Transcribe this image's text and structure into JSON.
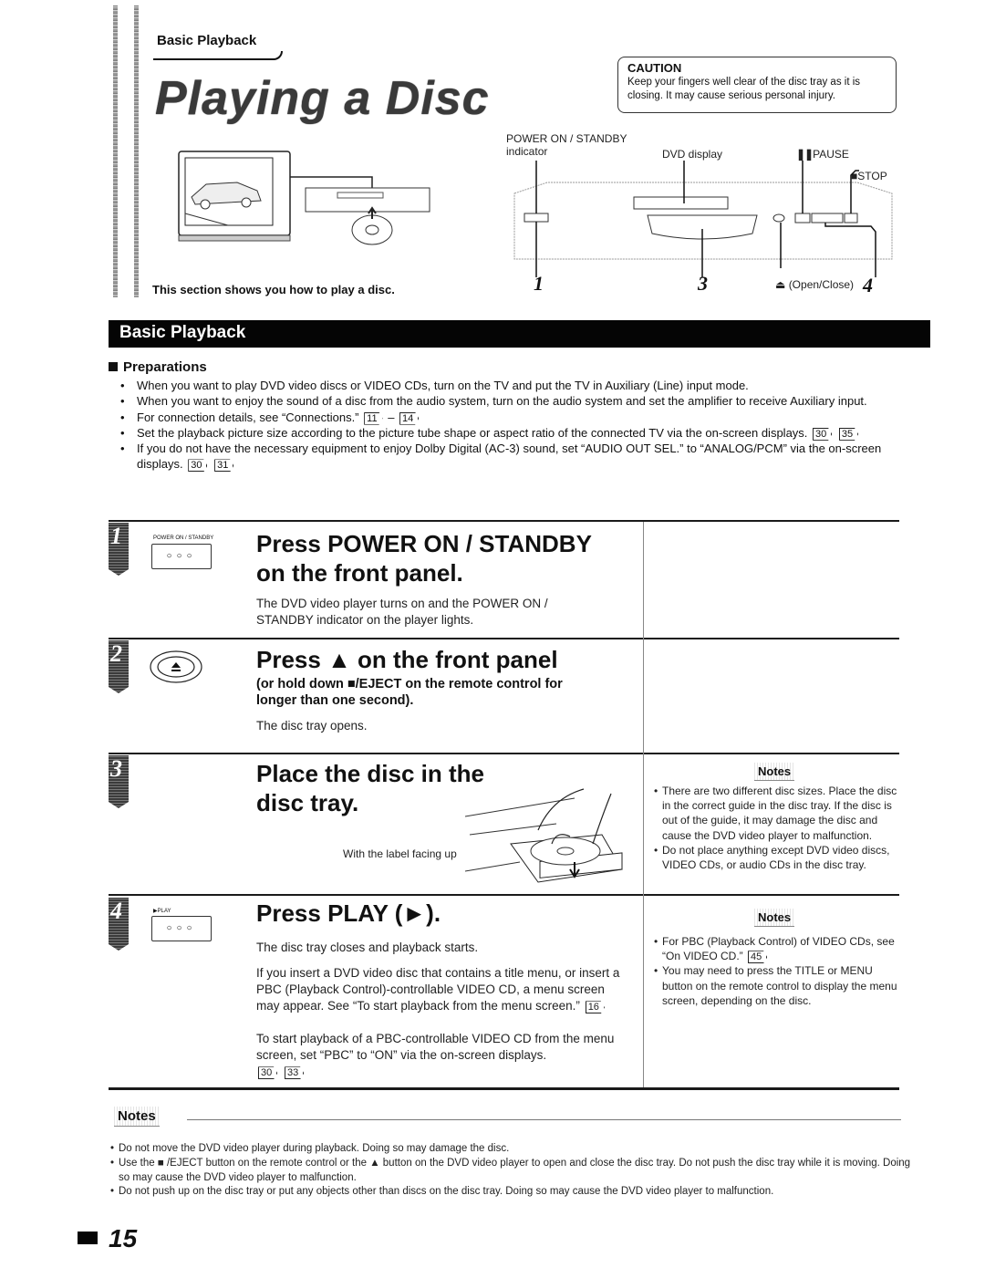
{
  "header": {
    "breadcrumb": "Basic Playback",
    "title": "Playing a Disc",
    "section_intro": "This section shows you how to play a disc."
  },
  "caution": {
    "title": "CAUTION",
    "text": "Keep your fingers well clear of the disc tray as it is closing. It may cause serious personal injury."
  },
  "diagram": {
    "labels": {
      "power_indicator_line1": "POWER ON / STANDBY",
      "power_indicator_line2": "indicator",
      "dvd_display": "DVD display",
      "pause": "PAUSE",
      "stop": "STOP",
      "open_close": "(Open/Close)"
    },
    "icons": {
      "pause": "pause-icon",
      "stop": "stop-icon",
      "eject": "eject-icon"
    },
    "step_numbers": [
      "1",
      "3",
      "4"
    ]
  },
  "section_band": {
    "title": "Basic Playback"
  },
  "preparations": {
    "heading": "Preparations",
    "items": [
      {
        "text": "When you want to play DVD video discs or VIDEO CDs, turn on the TV and put the TV in Auxiliary (Line) input mode.",
        "refs": []
      },
      {
        "text": "When you want to enjoy the sound of a disc from the audio system, turn on the audio system and set the amplifier to receive Auxiliary input.",
        "refs": []
      },
      {
        "text": "For connection details, see “Connections.”",
        "refs": [
          "11",
          "14"
        ],
        "ref_sep": "–"
      },
      {
        "text": "Set the playback picture size according to the picture tube shape or aspect ratio of the connected TV via the on-screen displays.",
        "refs": [
          "30",
          "35"
        ]
      },
      {
        "text": "If you do not have the necessary equipment to enjoy Dolby Digital (AC-3) sound, set “AUDIO OUT SEL.” to “ANALOG/PCM” via the on-screen displays.",
        "refs": [
          "30",
          "31"
        ]
      }
    ]
  },
  "steps": [
    {
      "number": "1",
      "panel_label": "POWER ON / STANDBY",
      "panel_buttons": "○○○",
      "heading_line1": "Press POWER ON / STANDBY",
      "heading_line2": "on the front panel.",
      "body": "The DVD video player turns on and the POWER ON / STANDBY indicator on the player lights."
    },
    {
      "number": "2",
      "panel_icon": "eject-button-icon",
      "heading": "Press ▲ on the front panel",
      "subheading": "(or hold down ■/EJECT on the remote control for longer than one second).",
      "body": "The disc tray opens."
    },
    {
      "number": "3",
      "heading_line1": "Place the disc in the",
      "heading_line2": "disc tray.",
      "caption": "With the label facing up",
      "notes_label": "Notes",
      "notes": [
        "There are two different disc sizes. Place the disc in the correct guide in the disc tray. If the disc is out of the guide, it may damage the disc and cause the DVD video player to malfunction.",
        "Do not place anything except DVD video discs, VIDEO CDs, or audio CDs in the disc tray."
      ]
    },
    {
      "number": "4",
      "panel_label": "▶PLAY",
      "panel_buttons": "○○○",
      "heading": "Press PLAY (►).",
      "body1": "The disc tray closes and playback starts.",
      "body2": "If you insert a DVD video disc that contains a title menu, or insert a PBC (Playback Control)-controllable VIDEO CD, a menu screen may appear. See “To start playback from the menu screen.”",
      "body2_ref": "16",
      "body3": "To start playback of a PBC-controllable VIDEO CD from the menu screen, set “PBC” to “ON” via the on-screen displays.",
      "body3_refs": [
        "30",
        "33"
      ],
      "notes_label": "Notes",
      "notes": [
        {
          "text": "For PBC (Playback Control) of VIDEO CDs, see “On VIDEO CD.”",
          "ref": "45"
        },
        {
          "text": "You may need to press the TITLE or MENU button on the remote control to display the menu screen, depending on the disc.",
          "ref": null
        }
      ]
    }
  ],
  "footer_notes": {
    "label": "Notes",
    "items": [
      "Do not move the DVD video player during playback. Doing so may damage the disc.",
      "Use the ■ /EJECT button on the remote control or the ▲ button on the DVD video player to open and close the disc tray. Do not push the disc tray while it is moving. Doing so may cause the DVD video player to malfunction.",
      "Do not push up on the disc tray or put any objects other than discs on the disc tray. Doing so may cause the DVD video player to malfunction."
    ]
  },
  "page_number": "15"
}
